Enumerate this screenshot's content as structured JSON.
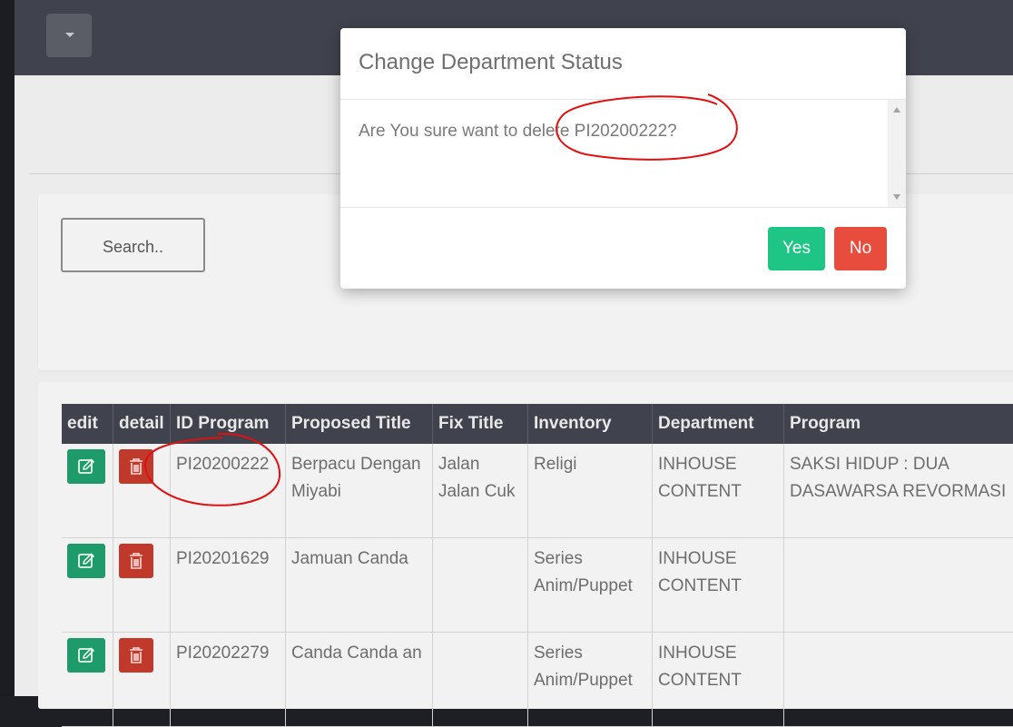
{
  "search": {
    "label": "Search.."
  },
  "table": {
    "columns": [
      "edit",
      "detail",
      "ID Program",
      "Proposed Title",
      "Fix Title",
      "Inventory",
      "Department",
      "Program"
    ],
    "rows": [
      {
        "id": "PI20200222",
        "proposed": "Berpacu Dengan Miyabi",
        "fix": "Jalan Jalan Cuk",
        "inventory": "Religi",
        "department": "INHOUSE CONTENT",
        "program": "SAKSI HIDUP : DUA DASAWARSA REVORMASI"
      },
      {
        "id": "PI20201629",
        "proposed": "Jamuan Canda",
        "fix": "",
        "inventory": "Series Anim/Puppet",
        "department": "INHOUSE CONTENT",
        "program": ""
      },
      {
        "id": "PI20202279",
        "proposed": "Canda Canda an",
        "fix": "",
        "inventory": "Series Anim/Puppet",
        "department": "INHOUSE CONTENT",
        "program": ""
      }
    ]
  },
  "modal": {
    "title": "Change Department Status",
    "message": "Are You sure want to delete PI20200222?",
    "yes_label": "Yes",
    "no_label": "No"
  },
  "colors": {
    "topbar": "#40424d",
    "edit_button": "#1f9a6a",
    "delete_button": "#c0392b",
    "yes_button": "#1fc585",
    "no_button": "#e84c3d",
    "annotation": "#e01010"
  },
  "icons": {
    "toggle": "caret-down-icon",
    "edit": "edit-icon",
    "delete": "trash-icon"
  }
}
